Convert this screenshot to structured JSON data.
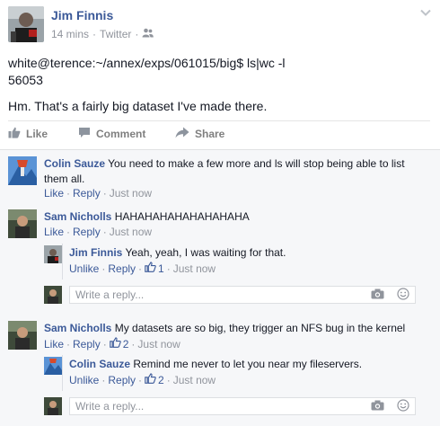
{
  "post": {
    "author": "Jim Finnis",
    "time": "14 mins",
    "source": "Twitter",
    "lines": [
      "white@terence:~/annex/exps/061015/big$ ls|wc -l",
      "56053",
      "Hm. That's a fairly big dataset I've made there."
    ],
    "actions": {
      "like": "Like",
      "comment": "Comment",
      "share": "Share"
    }
  },
  "comments": [
    {
      "author": "Colin Sauze",
      "text": "You need to make a few more and ls will stop being able to list",
      "text2": "them all.",
      "like": "Like",
      "reply": "Reply",
      "time": "Just now"
    },
    {
      "author": "Sam Nicholls",
      "text": "HAHAHAHAHAHAHAHAHA",
      "like": "Like",
      "reply": "Reply",
      "time": "Just now",
      "replies": [
        {
          "author": "Jim Finnis",
          "text": "Yeah, yeah, I was waiting for that.",
          "like": "Unlike",
          "reply": "Reply",
          "likes": "1",
          "time": "Just now"
        }
      ],
      "reply_placeholder": "Write a reply..."
    },
    {
      "author": "Sam Nicholls",
      "text": "My datasets are so big, they trigger an NFS bug in the kernel",
      "like": "Like",
      "reply": "Reply",
      "likes": "2",
      "time": "Just now",
      "replies": [
        {
          "author": "Colin Sauze",
          "text": "Remind me never to let you near my fileservers.",
          "like": "Unlike",
          "reply": "Reply",
          "likes": "2",
          "time": "Just now"
        }
      ],
      "reply_placeholder": "Write a reply..."
    }
  ],
  "colors": {
    "link": "#3b5998",
    "meta": "#90949c",
    "bg_comments": "#f6f7f9"
  },
  "icons": [
    "chevron-down-icon",
    "friends-audience-icon",
    "like-icon",
    "comment-icon",
    "share-icon",
    "camera-icon",
    "emoji-icon",
    "thumbs-up-icon"
  ]
}
